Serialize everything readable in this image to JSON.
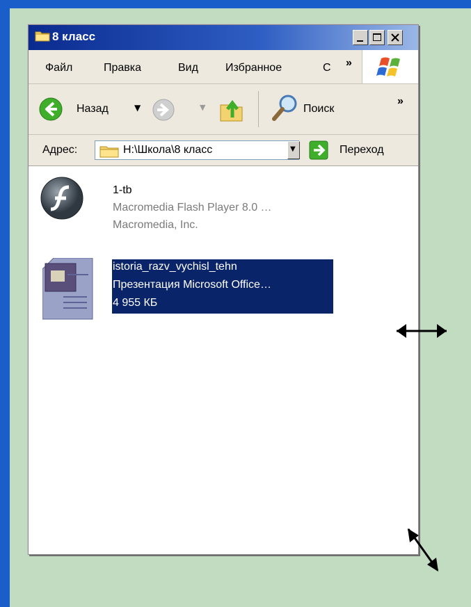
{
  "window": {
    "title": "8 класс"
  },
  "menu": {
    "items": [
      "Файл",
      "Правка",
      "Вид",
      "Избранное",
      "С"
    ],
    "more": "»"
  },
  "toolbar": {
    "back_label": "Назад",
    "search_label": "Поиск",
    "more": "»"
  },
  "address": {
    "label": "Адрес:",
    "value": "H:\\Школа\\8 класс",
    "go_label": "Переход"
  },
  "files": [
    {
      "name": "1-tb",
      "type": "Macromedia Flash Player 8.0  …",
      "detail": "Macromedia, Inc.",
      "icon": "flash-player-icon",
      "selected": false
    },
    {
      "name": "istoria_razv_vychisl_tehn",
      "type": "Презентация Microsoft Office…",
      "detail": "4 955 КБ",
      "icon": "powerpoint-file-icon",
      "selected": true
    }
  ],
  "colors": {
    "frame": "#1a5fc9",
    "background": "#c2dcc2",
    "selection": "#0a246a"
  }
}
